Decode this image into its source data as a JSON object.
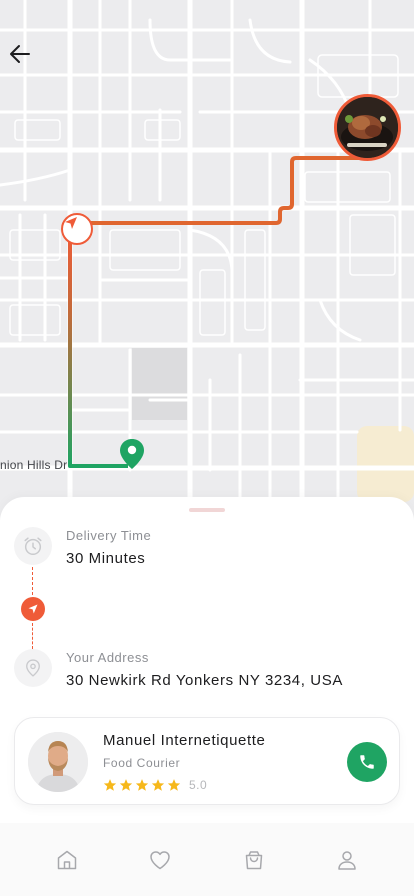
{
  "map": {
    "road_label": "nion Hills Dr",
    "route_colors": {
      "start": "#ef5b38",
      "end": "#1fa463"
    }
  },
  "icons": {
    "back": "arrow-left-icon",
    "origin": "navigation-arrow-icon",
    "destination": "map-pin-icon",
    "clock": "alarm-clock-icon",
    "location": "location-pin-icon",
    "call": "phone-icon"
  },
  "delivery": {
    "time_label": "Delivery Time",
    "time_value": "30 Minutes",
    "address_label": "Your Address",
    "address_value": "30 Newkirk Rd Yonkers NY 3234, USA"
  },
  "courier": {
    "name": "Manuel Internetiquette",
    "role": "Food Courier",
    "stars": 5,
    "rating": "5.0"
  },
  "tabbar": {
    "items": [
      "home-icon",
      "heart-icon",
      "shopping-bag-icon",
      "user-icon"
    ]
  },
  "colors": {
    "accent": "#ef5b38",
    "call": "#1fa463",
    "star": "#f6b81b"
  }
}
